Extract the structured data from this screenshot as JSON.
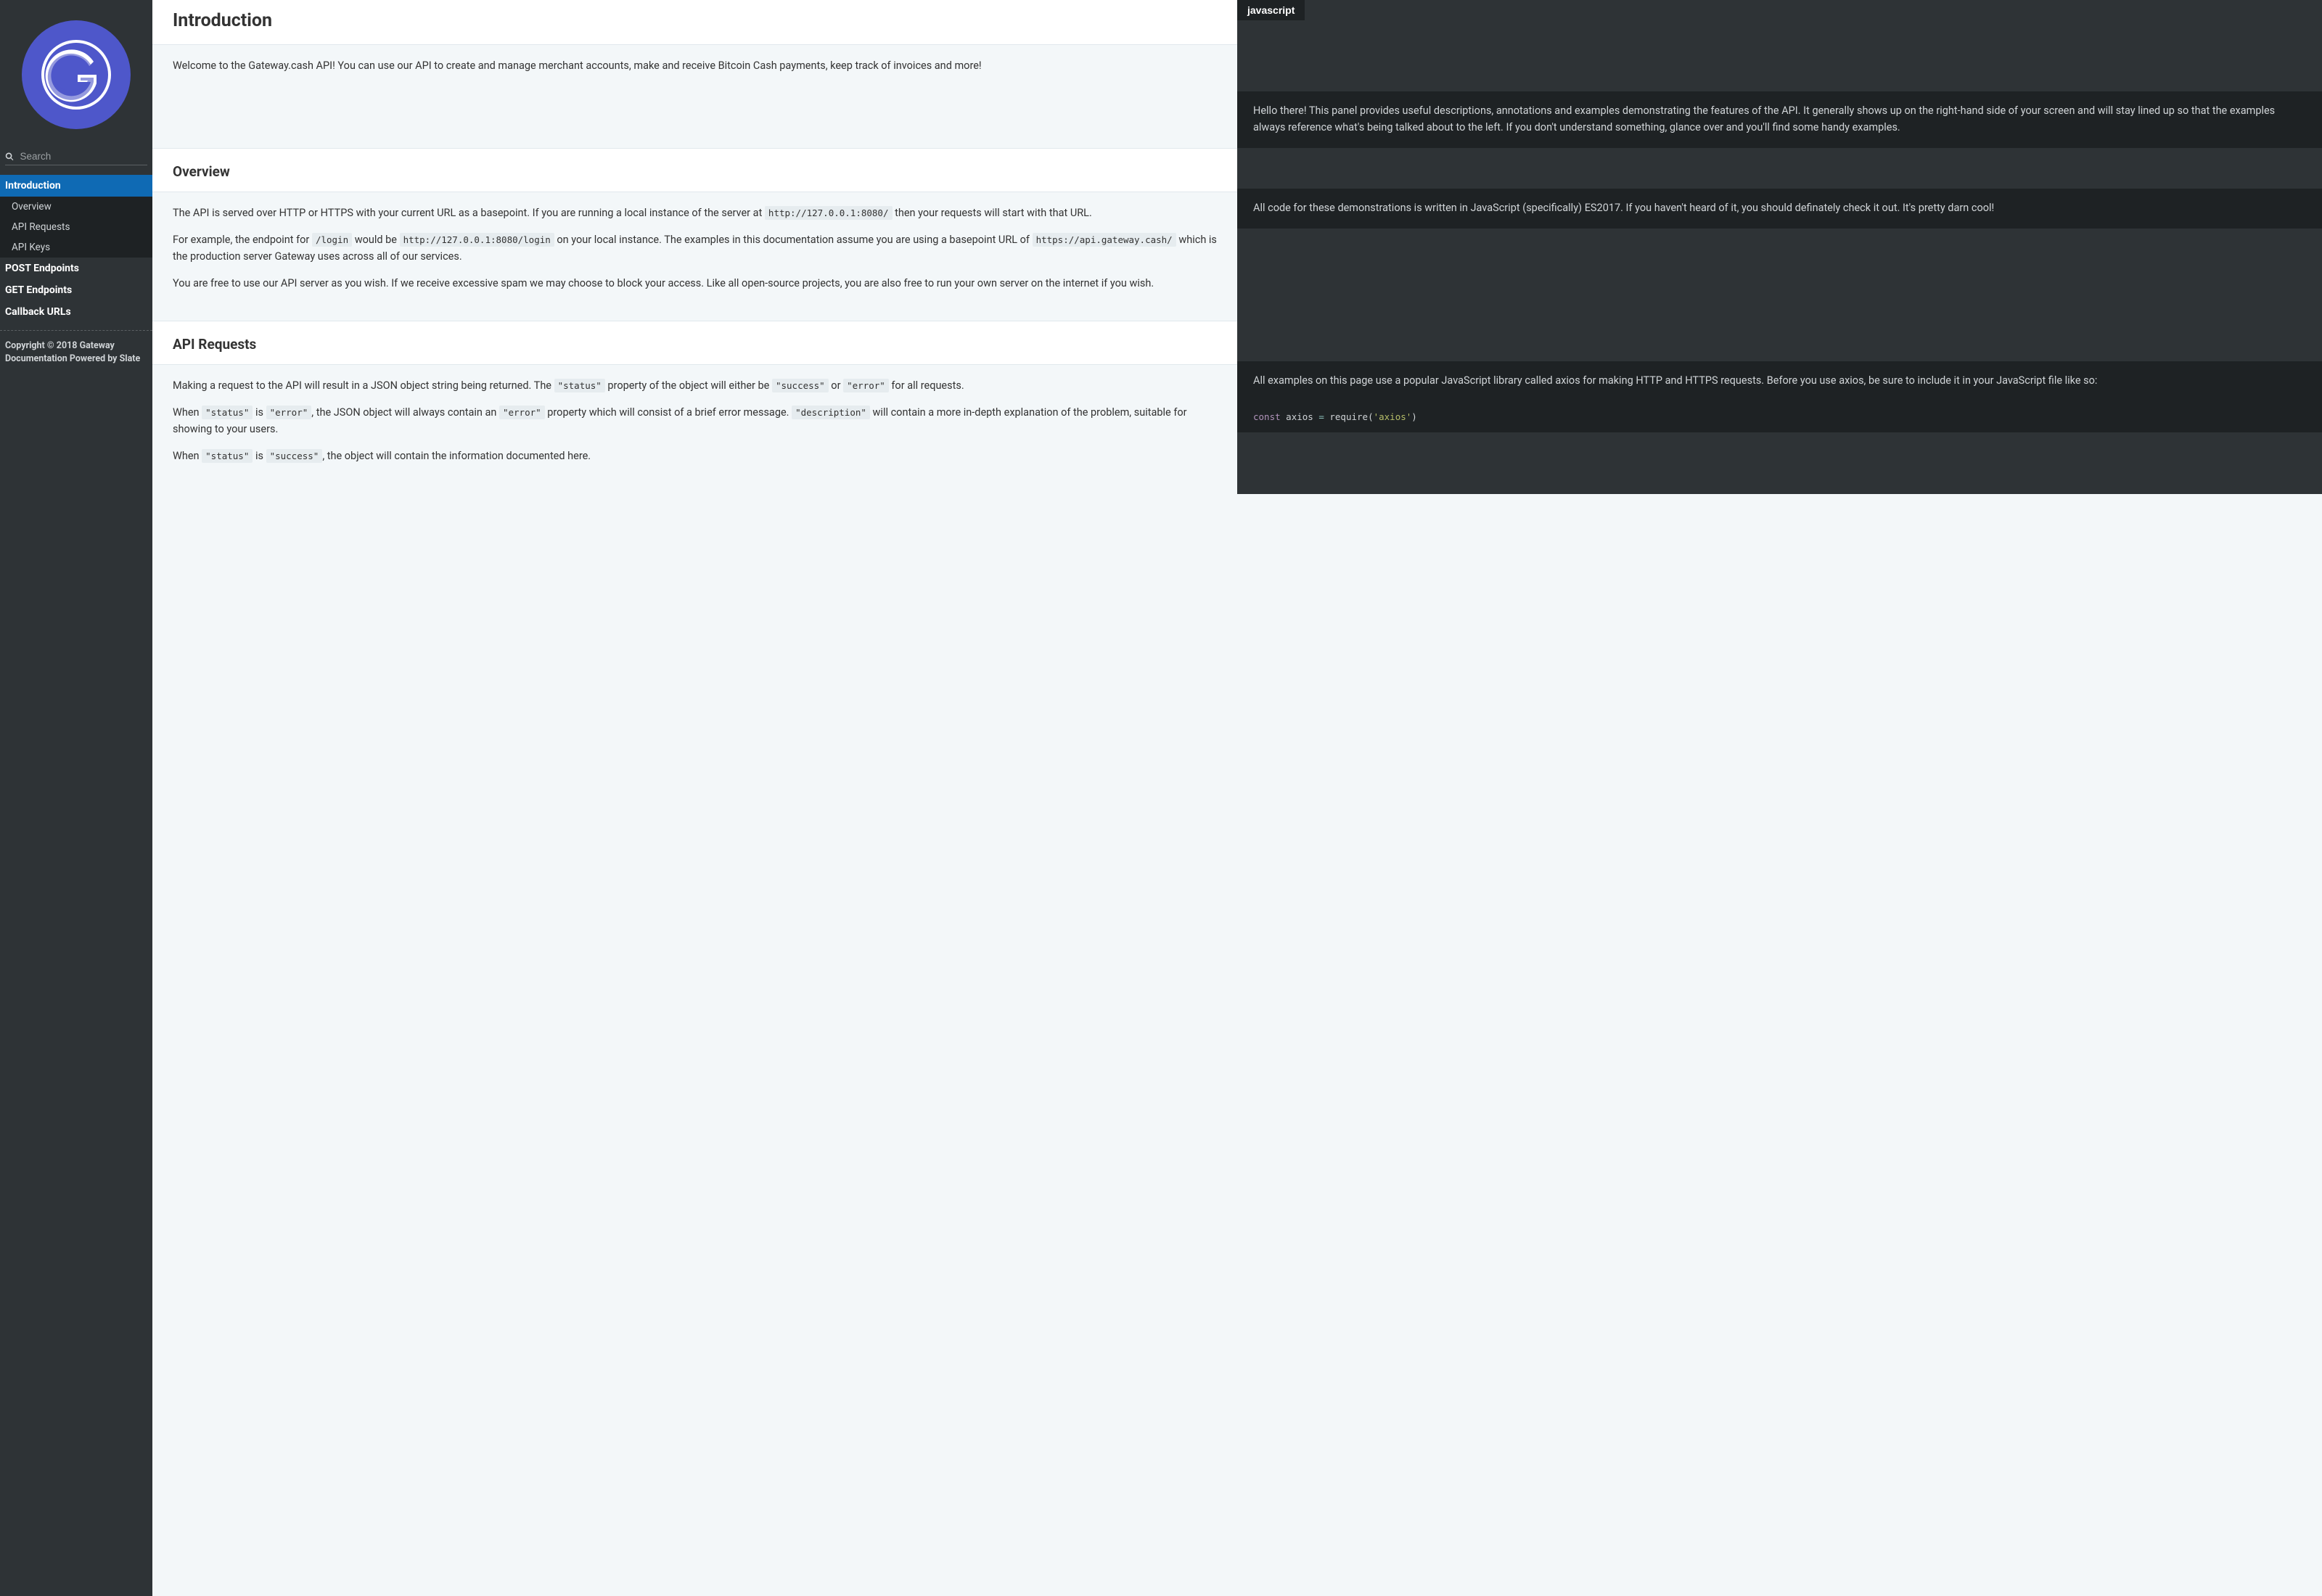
{
  "sidebar": {
    "search_placeholder": "Search",
    "items": [
      {
        "label": "Introduction",
        "active": true
      },
      {
        "label": "POST Endpoints",
        "active": false
      },
      {
        "label": "GET Endpoints",
        "active": false
      },
      {
        "label": "Callback URLs",
        "active": false
      }
    ],
    "sub_items": [
      {
        "label": "Overview"
      },
      {
        "label": "API Requests"
      },
      {
        "label": "API Keys"
      }
    ],
    "copyright": "Copyright © 2018 Gateway Documentation Powered by Slate"
  },
  "lang_tab": "javascript",
  "sections": {
    "introduction": {
      "title": "Introduction",
      "body": "Welcome to the Gateway.cash API! You can use our API to create and manage merchant accounts, make and receive Bitcoin Cash payments, keep track of invoices and more!",
      "aside": "Hello there! This panel provides useful descriptions, annotations and examples demonstrating the features of the API. It generally shows up on the right-hand side of your screen and will stay lined up so that the examples always reference what's being talked about to the left. If you don't understand something, glance over and you'll find some handy examples."
    },
    "overview": {
      "title": "Overview",
      "p1a": "The API is served over HTTP or HTTPS with your current URL as a basepoint. If you are running a local instance of the server at ",
      "p1_code1": "http://127.0.0.1:8080/",
      "p1b": " then your requests will start with that URL.",
      "p2a": "For example, the endpoint for ",
      "p2_code1": "/login",
      "p2b": " would be ",
      "p2_code2": "http://127.0.0.1:8080/login",
      "p2c": " on your local instance. The examples in this documentation assume you are using a basepoint URL of ",
      "p2_code3": "https://api.gateway.cash/",
      "p2d": " which is the production server Gateway uses across all of our services.",
      "p3": "You are free to use our API server as you wish. If we receive excessive spam we may choose to block your access. Like all open-source projects, you are also free to run your own server on the internet if you wish.",
      "aside": "All code for these demonstrations is written in JavaScript (specifically) ES2017. If you haven't heard of it, you should definately check it out. It's pretty darn cool!"
    },
    "api_requests": {
      "title": "API Requests",
      "p1a": "Making a request to the API will result in a JSON object string being returned. The ",
      "p1_code1": "\"status\"",
      "p1b": " property of the object will either be ",
      "p1_code2": "\"success\"",
      "p1c": " or ",
      "p1_code3": "\"error\"",
      "p1d": " for all requests.",
      "p2a": "When ",
      "p2_code1": "\"status\"",
      "p2b": " is ",
      "p2_code2": "\"error\"",
      "p2c": ", the JSON object will always contain an ",
      "p2_code3": "\"error\"",
      "p2d": " property which will consist of a brief error message. ",
      "p2_code4": "\"description\"",
      "p2e": " will contain a more in-depth explanation of the problem, suitable for showing to your users.",
      "p3a": "When ",
      "p3_code1": "\"status\"",
      "p3b": " is ",
      "p3_code2": "\"success\"",
      "p3c": ", the object will contain the information documented here.",
      "aside": "All examples on this page use a popular JavaScript library called axios for making HTTP and HTTPS requests. Before you use axios, be sure to include it in your JavaScript file like so:",
      "code": {
        "kw": "const",
        "name": " axios ",
        "op": "=",
        "fn": " require(",
        "str": "'axios'",
        "close": ")"
      }
    }
  }
}
